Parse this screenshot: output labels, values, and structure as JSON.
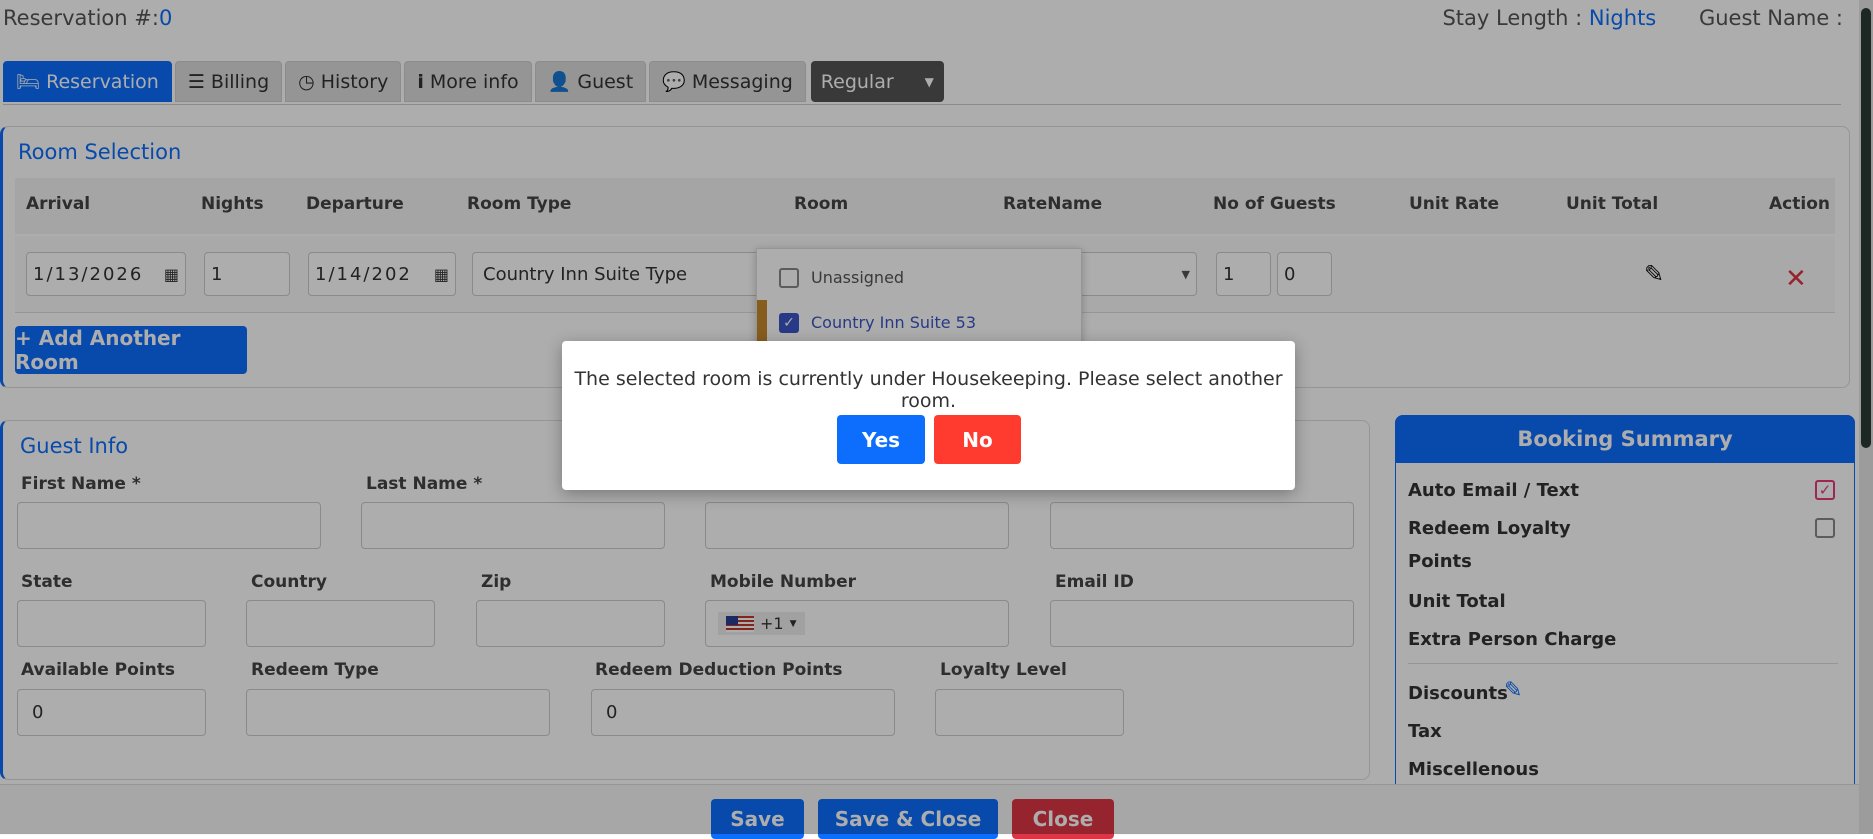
{
  "header": {
    "reservation_label": "Reservation #:",
    "reservation_number": "0",
    "stay_length_label": "Stay Length :",
    "stay_length_value": "Nights",
    "guest_name_label": "Guest Name :"
  },
  "tabs": [
    {
      "label": "Reservation",
      "icon": "bed-icon"
    },
    {
      "label": "Billing",
      "icon": "list-icon"
    },
    {
      "label": "History",
      "icon": "clock-icon"
    },
    {
      "label": "More info",
      "icon": "info-icon"
    },
    {
      "label": "Guest",
      "icon": "user-icon"
    },
    {
      "label": "Messaging",
      "icon": "chat-icon"
    }
  ],
  "tab_select": {
    "value": "Regular"
  },
  "room_selection": {
    "title": "Room Selection",
    "columns": [
      "Arrival",
      "Nights",
      "Departure",
      "Room Type",
      "Room",
      "RateName",
      "No of Guests",
      "Unit Rate",
      "Unit Total",
      "Action"
    ],
    "row": {
      "arrival": "1/13/2026",
      "nights": "1",
      "departure": "1/14/202",
      "room_type": "Country Inn Suite Type",
      "guests_adults": "1",
      "guests_children": "0"
    },
    "room_dropdown": [
      {
        "label": "Unassigned",
        "checked": false
      },
      {
        "label": "Country Inn Suite 53",
        "checked": true
      }
    ],
    "add_room_label": "+ Add Another Room"
  },
  "guest_info": {
    "title": "Guest Info",
    "first_name_label": "First Name *",
    "last_name_label": "Last Name *",
    "state_label": "State",
    "country_label": "Country",
    "zip_label": "Zip",
    "mobile_label": "Mobile Number",
    "dial_code": "+1",
    "email_label": "Email ID",
    "available_points_label": "Available Points",
    "available_points_value": "0",
    "redeem_type_label": "Redeem Type",
    "redeem_deduction_label": "Redeem Deduction Points",
    "redeem_deduction_value": "0",
    "loyalty_level_label": "Loyalty Level"
  },
  "booking_summary": {
    "title": "Booking Summary",
    "auto_email": "Auto Email / Text",
    "redeem_loyalty_1": "Redeem Loyalty",
    "redeem_loyalty_2": "Points",
    "unit_total": "Unit Total",
    "extra_person": "Extra Person Charge",
    "discounts": "Discounts",
    "tax": "Tax",
    "misc": "Miscellenous"
  },
  "footer": {
    "save": "Save",
    "save_close": "Save & Close",
    "close": "Close"
  },
  "modal": {
    "message": "The selected room is currently under Housekeeping. Please select another room.",
    "yes": "Yes",
    "no": "No"
  },
  "colors": {
    "primary": "#0d6efd",
    "danger": "#ff3b2f",
    "summary_check": "#e8387a"
  }
}
